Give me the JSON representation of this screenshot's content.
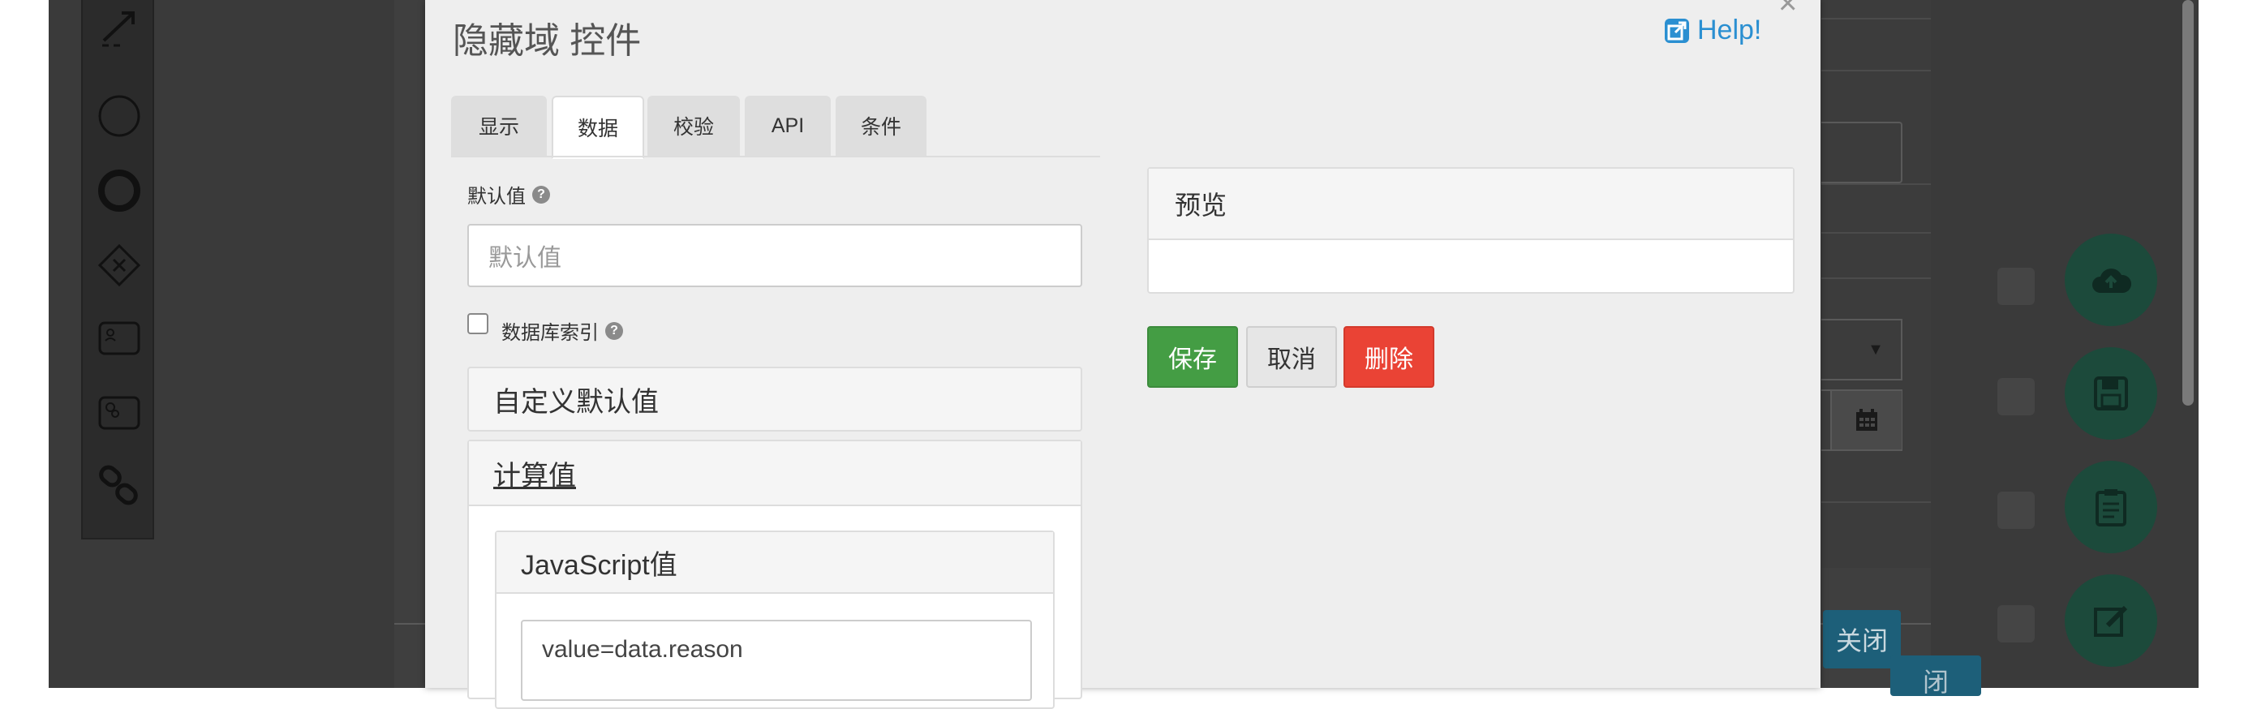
{
  "modal": {
    "title": "隐藏域 控件",
    "close_symbol": "×",
    "help_label": "Help!"
  },
  "tabs": [
    {
      "label": "显示",
      "active": false
    },
    {
      "label": "数据",
      "active": true
    },
    {
      "label": "校验",
      "active": false
    },
    {
      "label": "API",
      "active": false
    },
    {
      "label": "条件",
      "active": false
    }
  ],
  "form": {
    "default_value_label": "默认值",
    "default_value_placeholder": "默认值",
    "db_index_label": "数据库索引",
    "db_index_checked": false,
    "help_glyph": "?",
    "custom_default_label": "自定义默认值",
    "calculated_label": "计算值",
    "js_value_label": "JavaScript值",
    "js_code": "value=data.reason"
  },
  "preview": {
    "title": "预览"
  },
  "actions": {
    "save_label": "保存",
    "cancel_label": "取消",
    "delete_label": "删除"
  },
  "background": {
    "close_button_label": "关闭",
    "close_button_label_partial": "闭"
  },
  "colors": {
    "primary_link": "#2a8fd1",
    "save_green": "#449d44",
    "delete_red": "#ea4335",
    "fab_green": "#1c4a3b"
  }
}
